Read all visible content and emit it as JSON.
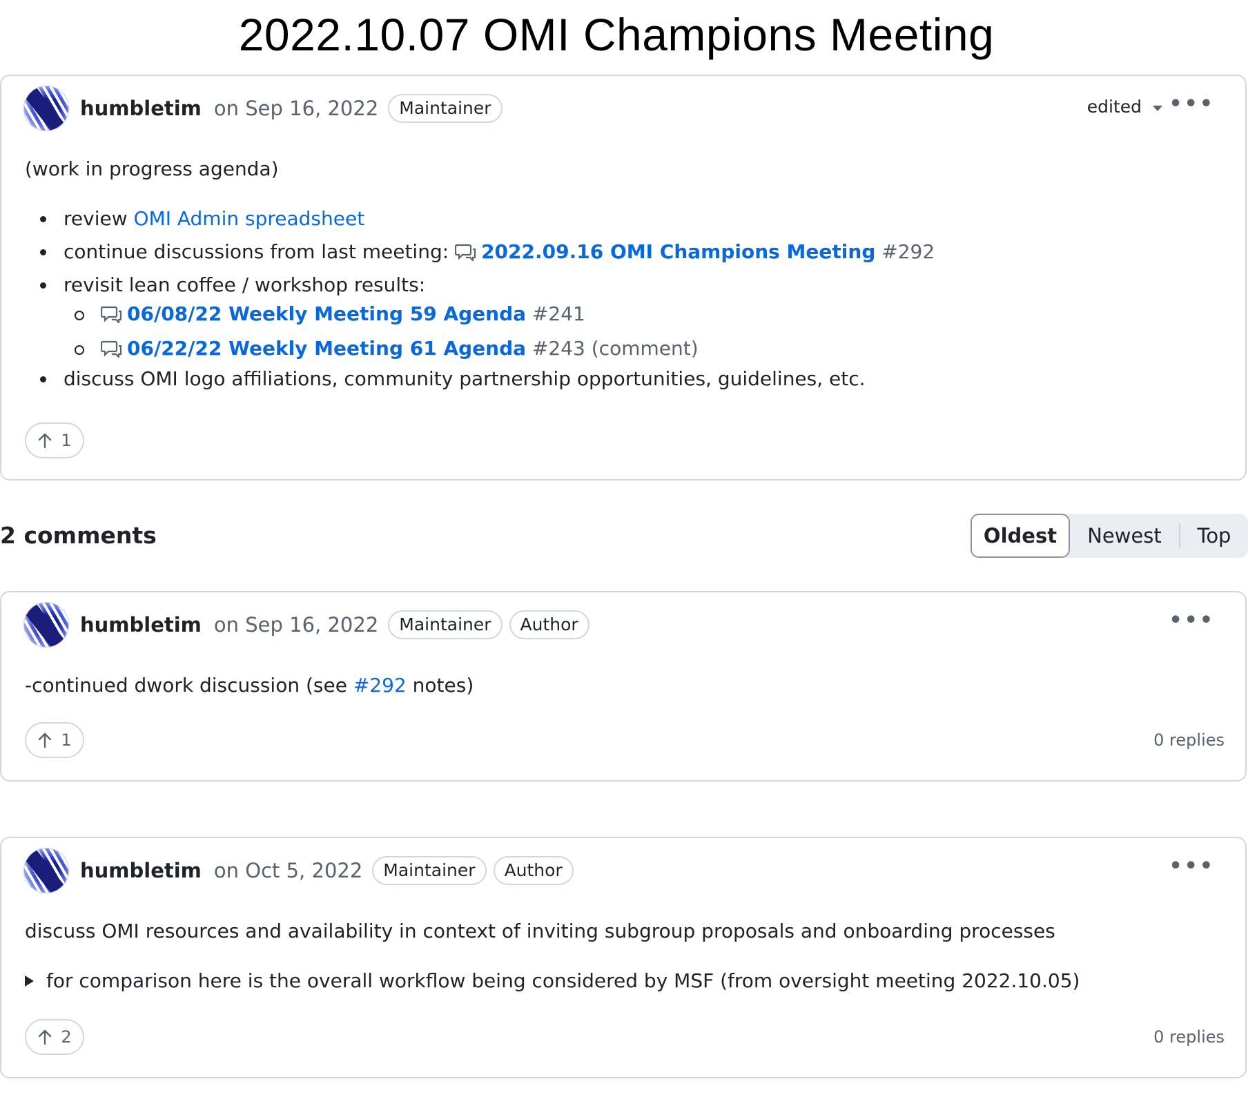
{
  "page": {
    "title": "2022.10.07 OMI Champions Meeting"
  },
  "main_post": {
    "author": "humbletim",
    "date": "on Sep 16, 2022",
    "badge": "Maintainer",
    "edited_label": "edited",
    "intro": "(work in progress agenda)",
    "items": [
      {
        "prefix": "review ",
        "link": "OMI Admin spreadsheet"
      },
      {
        "prefix": "continue discussions from last meeting: ",
        "link": "2022.09.16 OMI Champions Meeting",
        "ref": "#292"
      },
      {
        "prefix": "revisit lean coffee / workshop results:"
      },
      {
        "text": "discuss OMI logo affiliations, community partnership opportunities, guidelines, etc."
      }
    ],
    "subitems": [
      {
        "link": "06/08/22 Weekly Meeting 59 Agenda",
        "ref": "#241",
        "suffix": ""
      },
      {
        "link": "06/22/22 Weekly Meeting 61 Agenda",
        "ref": "#243",
        "suffix": " (comment)"
      }
    ],
    "upvotes": "1"
  },
  "comments_header": {
    "count_label": "2 comments",
    "sort": {
      "oldest": "Oldest",
      "newest": "Newest",
      "top": "Top"
    }
  },
  "comments": [
    {
      "author": "humbletim",
      "date": "on Sep 16, 2022",
      "badges": [
        "Maintainer",
        "Author"
      ],
      "body_prefix": "-continued dwork discussion (see ",
      "body_link": "#292",
      "body_suffix": " notes)",
      "upvotes": "1",
      "replies": "0 replies"
    },
    {
      "author": "humbletim",
      "date": "on Oct 5, 2022",
      "badges": [
        "Maintainer",
        "Author"
      ],
      "body": "discuss OMI resources and availability in context of inviting subgroup proposals and onboarding processes",
      "details_summary": "for comparison here is the overall workflow being considered by MSF (from oversight meeting 2022.10.05)",
      "upvotes": "2",
      "replies": "0 replies"
    }
  ],
  "icons": {
    "avatar": "user-avatar",
    "discussion": "discussion-icon",
    "upvote": "arrow-up-icon",
    "menu": "kebab-horizontal-icon",
    "dropdown": "triangle-down-icon",
    "details": "triangle-right-icon"
  },
  "colors": {
    "link": "#0969da",
    "border": "#d0d7de",
    "muted": "#59636e",
    "text": "#1f2328"
  }
}
